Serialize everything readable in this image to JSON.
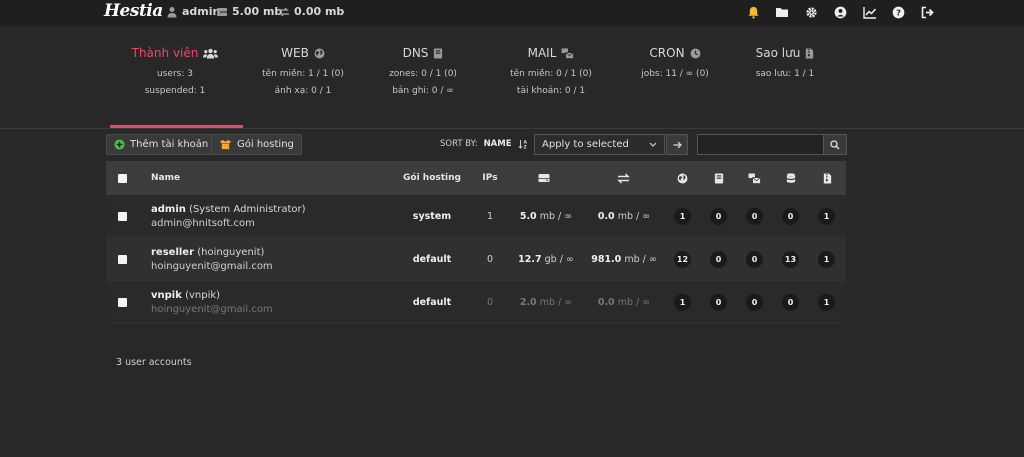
{
  "topbar": {
    "logo": "Hestia",
    "user": "admin",
    "disk": "5.00 mb",
    "bandwidth": "0.00 mb"
  },
  "panels": [
    {
      "title": "Thành viên",
      "icon": "users-icon",
      "stats": [
        "users: 3",
        "suspended: 1"
      ],
      "active": true
    },
    {
      "title": "WEB",
      "icon": "globe-icon",
      "stats": [
        "tên miền: 1 / 1 (0)",
        "ánh xạ: 0 / 1"
      ],
      "active": false
    },
    {
      "title": "DNS",
      "icon": "book-icon",
      "stats": [
        "zones: 0 / 1 (0)",
        "bản ghi: 0 / ∞"
      ],
      "active": false
    },
    {
      "title": "MAIL",
      "icon": "mail-bulk-icon",
      "stats": [
        "tên miền: 0 / 1 (0)",
        "tài khoản: 0 / 1"
      ],
      "active": false
    },
    {
      "title": "CRON",
      "icon": "clock-icon",
      "stats": [
        "jobs: 11 / ∞ (0)"
      ],
      "active": false
    },
    {
      "title": "Sao lưu",
      "icon": "file-archive-icon",
      "stats": [
        "sao lưu: 1 / 1"
      ],
      "active": false
    }
  ],
  "toolbar": {
    "add_user_label": "Thêm tài khoản",
    "packages_label": "Gói hosting",
    "sort_by_label": "SORT BY:",
    "sort_value": "NAME",
    "bulk_select": "Apply to selected",
    "search_placeholder": ""
  },
  "table": {
    "headers": {
      "name": "Name",
      "package": "Gói hosting",
      "ips": "IPs"
    },
    "rows": [
      {
        "username": "admin",
        "fullname": "(System Administrator)",
        "email": "admin@hnitsoft.com",
        "package": "system",
        "ips": "1",
        "disk_value": "5.0",
        "disk_unit": "mb / ∞",
        "bw_value": "0.0",
        "bw_unit": "mb / ∞",
        "web": "1",
        "dns": "0",
        "mail": "0",
        "db": "0",
        "backup": "1",
        "suspended": false
      },
      {
        "username": "reseller",
        "fullname": "(hoinguyenit)",
        "email": "hoinguyenit@gmail.com",
        "package": "default",
        "ips": "0",
        "disk_value": "12.7",
        "disk_unit": "gb / ∞",
        "bw_value": "981.0",
        "bw_unit": "mb / ∞",
        "web": "12",
        "dns": "0",
        "mail": "0",
        "db": "13",
        "backup": "1",
        "suspended": false
      },
      {
        "username": "vnpik",
        "fullname": "(vnpik)",
        "email": "hoinguyenit@gmail.com",
        "package": "default",
        "ips": "0",
        "disk_value": "2.0",
        "disk_unit": "mb / ∞",
        "bw_value": "0.0",
        "bw_unit": "mb / ∞",
        "web": "1",
        "dns": "0",
        "mail": "0",
        "db": "0",
        "backup": "1",
        "suspended": true
      }
    ]
  },
  "footer": {
    "count_text": "3 user accounts"
  },
  "colors": {
    "accent": "#e8496b",
    "bell": "#f5b82e",
    "add_icon": "#4cbb4a",
    "package_icon": "#f0a830"
  }
}
